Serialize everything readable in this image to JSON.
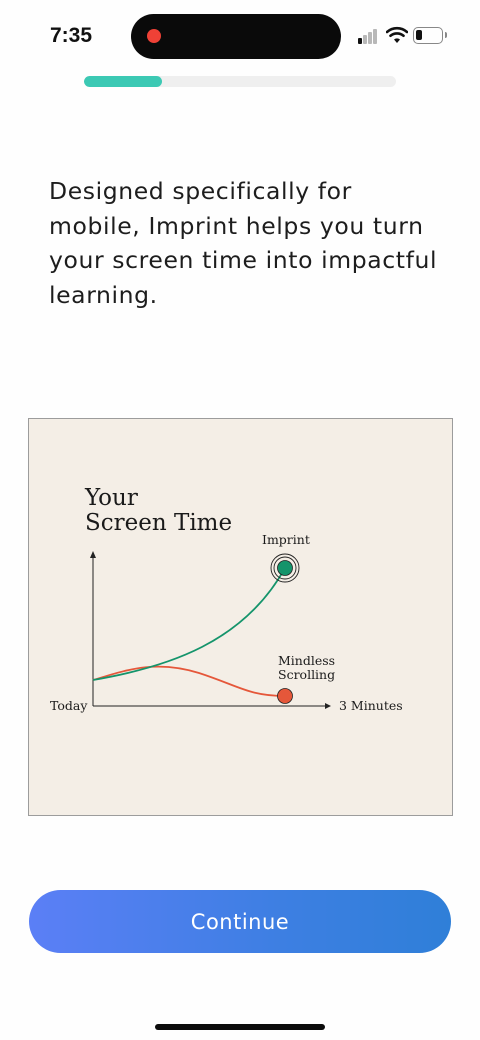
{
  "status_bar": {
    "time": "7:35",
    "record_indicator_color": "#ef4136",
    "signal_bars_active": 1,
    "signal_bars_total": 4,
    "battery_level": 0.25,
    "icons": [
      "signal-icon",
      "wifi-icon",
      "battery-icon"
    ]
  },
  "onboarding": {
    "progress_fraction": 0.25,
    "progress_color": "#3cc9b4",
    "intro_text": "Designed specifically for mobile, Imprint helps you turn your screen time into impactful learning."
  },
  "illustration": {
    "title_line1": "Your",
    "title_line2": "Screen Time",
    "x_start_label": "Today",
    "x_end_label": "3 Minutes",
    "imprint_label": "Imprint",
    "scrolling_label_line1": "Mindless",
    "scrolling_label_line2": "Scrolling",
    "imprint_color": "#14946b",
    "scrolling_color": "#e5573a",
    "background_color": "#f4eee6"
  },
  "actions": {
    "continue_label": "Continue"
  }
}
